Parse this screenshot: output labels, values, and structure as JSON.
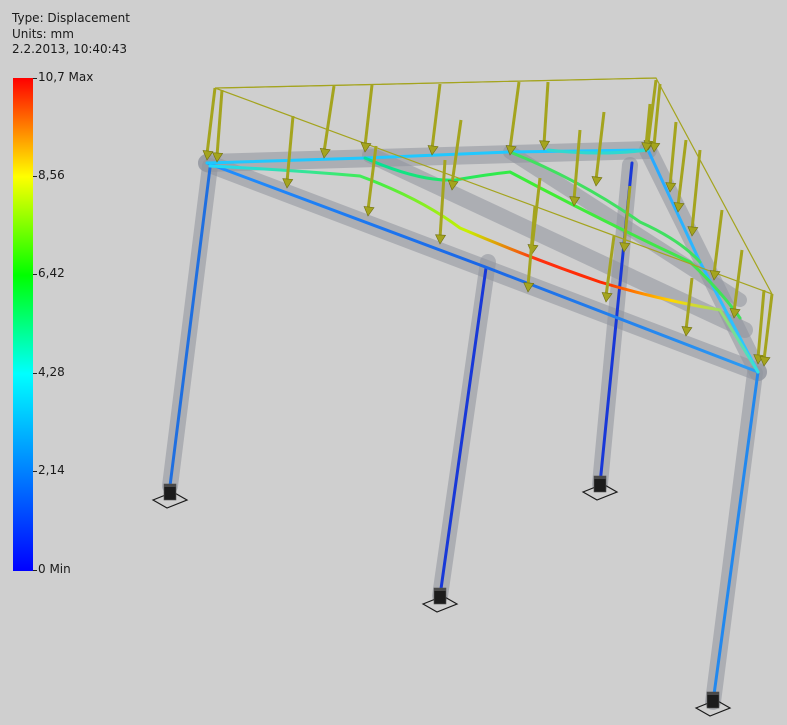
{
  "info": {
    "type_line": "Type: Displacement",
    "units_line": "Units: mm",
    "date_line": "2.2.2013, 10:40:43"
  },
  "legend": {
    "labels": [
      "10,7 Max",
      "8,56",
      "6,42",
      "4,28",
      "2,14",
      "0 Min"
    ],
    "colors": [
      "#ff0000",
      "#ff8000",
      "#ffff00",
      "#00ff00",
      "#00ffff",
      "#0080ff",
      "#0000ff"
    ]
  },
  "scene": {
    "background": "#cfcfcf",
    "load_arrow_color": "#a4a41e",
    "support_color": "#1c1c1c",
    "ghost_color": "#8f949c"
  }
}
